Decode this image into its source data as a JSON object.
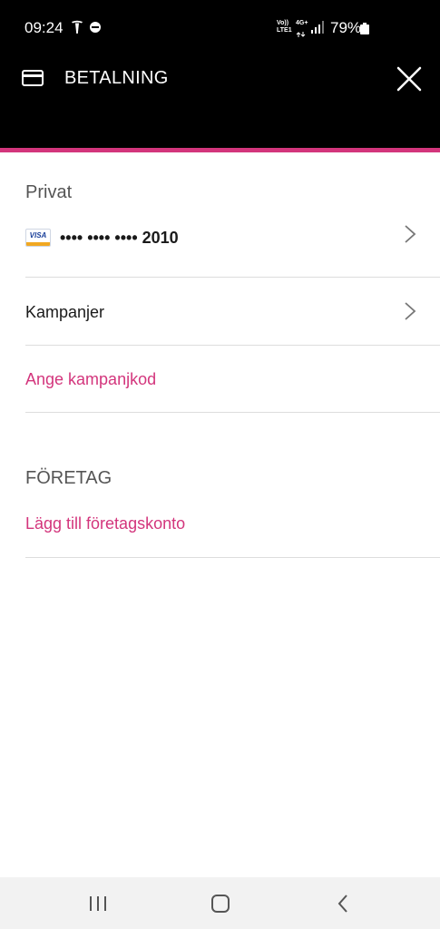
{
  "status_bar": {
    "time": "09:24",
    "network_volte": "Vo))",
    "network_lte": "LTE1",
    "network_gen": "4G+",
    "battery": "79%"
  },
  "header": {
    "title": "BETALNING",
    "icon": "credit-card-icon",
    "close_icon": "close-icon",
    "accent_color": "#d3357c"
  },
  "private": {
    "label": "Privat",
    "card": {
      "brand": "VISA",
      "masked_number": "•••• •••• •••• 2010"
    },
    "campaigns_label": "Kampanjer",
    "enter_code_label": "Ange kampanjkod"
  },
  "business": {
    "label": "FÖRETAG",
    "add_account_label": "Lägg till företagskonto"
  },
  "nav": {
    "recents_icon": "recents-icon",
    "home_icon": "home-icon",
    "back_icon": "back-icon"
  }
}
